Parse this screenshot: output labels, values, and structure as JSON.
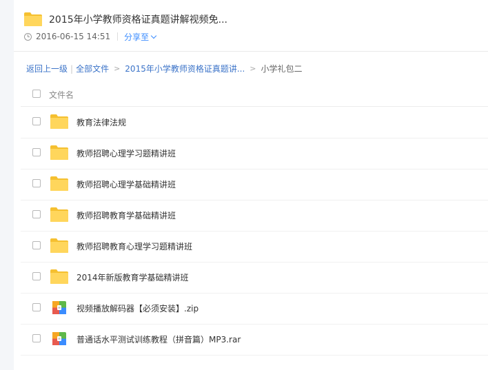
{
  "header": {
    "title": "2015年小学教师资格证真题讲解视频免...",
    "date": "2016-06-15 14:51",
    "share_label": "分享至"
  },
  "breadcrumb": {
    "back": "返回上一级",
    "all_files": "全部文件",
    "parent": "2015年小学教师资格证真题讲...",
    "current": "小学礼包二",
    "separator": ">"
  },
  "list": {
    "column_header": "文件名",
    "items": [
      {
        "name": "教育法律法规",
        "icon": "folder-icon"
      },
      {
        "name": "教师招聘心理学习题精讲班",
        "icon": "folder-icon"
      },
      {
        "name": "教师招聘心理学基础精讲班",
        "icon": "folder-icon"
      },
      {
        "name": "教师招聘教育学基础精讲班",
        "icon": "folder-icon"
      },
      {
        "name": "教师招聘教育心理学习题精讲班",
        "icon": "folder-icon"
      },
      {
        "name": "2014年新版教育学基础精讲班",
        "icon": "folder-icon"
      },
      {
        "name": "视频播放解码器【必须安装】.zip",
        "icon": "archive-icon"
      },
      {
        "name": "普通话水平测试训练教程（拼音篇）MP3.rar",
        "icon": "archive-icon"
      }
    ]
  },
  "colors": {
    "folder": "#ffd65c",
    "folder_tab": "#f5c030",
    "link": "#3b73c8",
    "accent": "#3b8cff"
  }
}
